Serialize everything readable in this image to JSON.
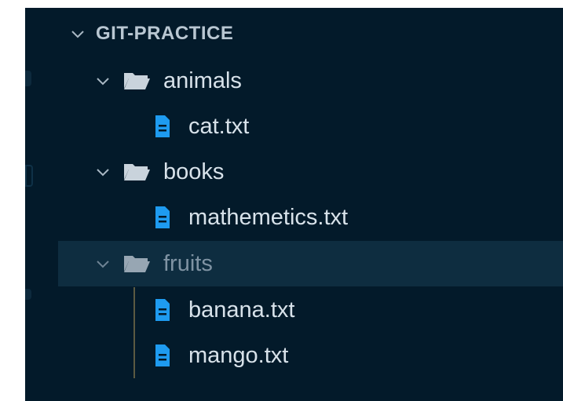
{
  "explorer": {
    "section_title": "GIT-PRACTICE",
    "tree": [
      {
        "kind": "folder",
        "label": "animals",
        "expanded": true,
        "icon": "folder-open-icon"
      },
      {
        "kind": "file",
        "label": "cat.txt",
        "icon": "file-text-icon"
      },
      {
        "kind": "folder",
        "label": "books",
        "expanded": true,
        "icon": "folder-open-icon"
      },
      {
        "kind": "file",
        "label": "mathemetics.txt",
        "icon": "file-text-icon"
      },
      {
        "kind": "folder",
        "label": "fruits",
        "expanded": true,
        "selected": true,
        "icon": "folder-open-icon"
      },
      {
        "kind": "file",
        "label": "banana.txt",
        "icon": "file-text-icon"
      },
      {
        "kind": "file",
        "label": "mango.txt",
        "icon": "file-text-icon"
      }
    ]
  },
  "colors": {
    "background": "#031a2a",
    "selected_row": "#0e2d40",
    "file_icon": "#1e9bf0",
    "folder_icon": "#c9d3dc",
    "text": "#d8e2ea"
  }
}
